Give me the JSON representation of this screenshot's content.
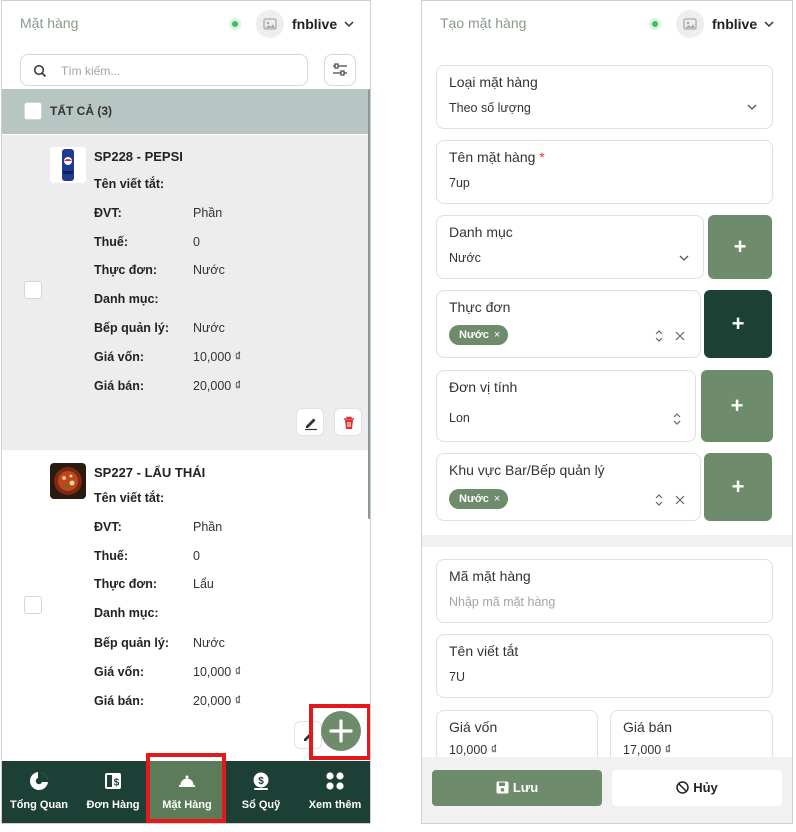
{
  "left": {
    "header": {
      "title": "Mặt hàng",
      "user": "fnblive"
    },
    "search": {
      "placeholder": "Tìm kiếm..."
    },
    "select_all_label": "TẤT CẢ (3)",
    "items": [
      {
        "title": "SP228 - PEPSI",
        "rows": [
          {
            "k": "Tên viết tắt:",
            "v": ""
          },
          {
            "k": "ĐVT:",
            "v": "Phần"
          },
          {
            "k": "Thuế:",
            "v": "0"
          },
          {
            "k": "Thực đơn:",
            "v": "Nước"
          },
          {
            "k": "Danh mục:",
            "v": ""
          },
          {
            "k": "Bếp quản lý:",
            "v": "Nước"
          },
          {
            "k": "Giá vốn:",
            "v": "10,000 ₫"
          },
          {
            "k": "Giá bán:",
            "v": "20,000 ₫"
          }
        ]
      },
      {
        "title": "SP227 - LẨU THÁI",
        "rows": [
          {
            "k": "Tên viết tắt:",
            "v": ""
          },
          {
            "k": "ĐVT:",
            "v": "Phần"
          },
          {
            "k": "Thuế:",
            "v": "0"
          },
          {
            "k": "Thực đơn:",
            "v": "Lẩu"
          },
          {
            "k": "Danh mục:",
            "v": ""
          },
          {
            "k": "Bếp quản lý:",
            "v": "Nước"
          },
          {
            "k": "Giá vốn:",
            "v": "10,000 ₫"
          },
          {
            "k": "Giá bán:",
            "v": "20,000 ₫"
          }
        ]
      }
    ],
    "nav": [
      {
        "label": "Tổng Quan",
        "icon": "pie-chart-icon"
      },
      {
        "label": "Đơn Hàng",
        "icon": "order-icon"
      },
      {
        "label": "Mặt Hàng",
        "icon": "cloche-icon",
        "active": true
      },
      {
        "label": "Sổ Quỹ",
        "icon": "money-bag-icon"
      },
      {
        "label": "Xem thêm",
        "icon": "grid-icon"
      }
    ]
  },
  "right": {
    "header": {
      "title": "Tạo mặt hàng",
      "user": "fnblive"
    },
    "fields": {
      "type": {
        "label": "Loại mặt hàng",
        "value": "Theo số lượng"
      },
      "name": {
        "label": "Tên mặt hàng",
        "required": "*",
        "value": "7up"
      },
      "category": {
        "label": "Danh mục",
        "value": "Nước"
      },
      "menu": {
        "label": "Thực đơn",
        "chip": "Nước"
      },
      "unit": {
        "label": "Đơn vị tính",
        "value": "Lon"
      },
      "kitchen": {
        "label": "Khu vực Bar/Bếp quản lý",
        "chip": "Nước"
      },
      "code": {
        "label": "Mã mặt hàng",
        "placeholder": "Nhập mã mặt hàng"
      },
      "short_name": {
        "label": "Tên viết tắt",
        "value": "7U"
      },
      "cost": {
        "label": "Giá vốn",
        "value": "10,000 ₫"
      },
      "price": {
        "label": "Giá bán",
        "value": "17,000 ₫"
      }
    },
    "footer": {
      "save": "Lưu",
      "cancel": "Hủy"
    }
  },
  "colors": {
    "brand_green": "#6e8b6b",
    "dark_green": "#1c4036",
    "highlight_red": "#e3191b",
    "online_dot": "#3dbf60"
  }
}
